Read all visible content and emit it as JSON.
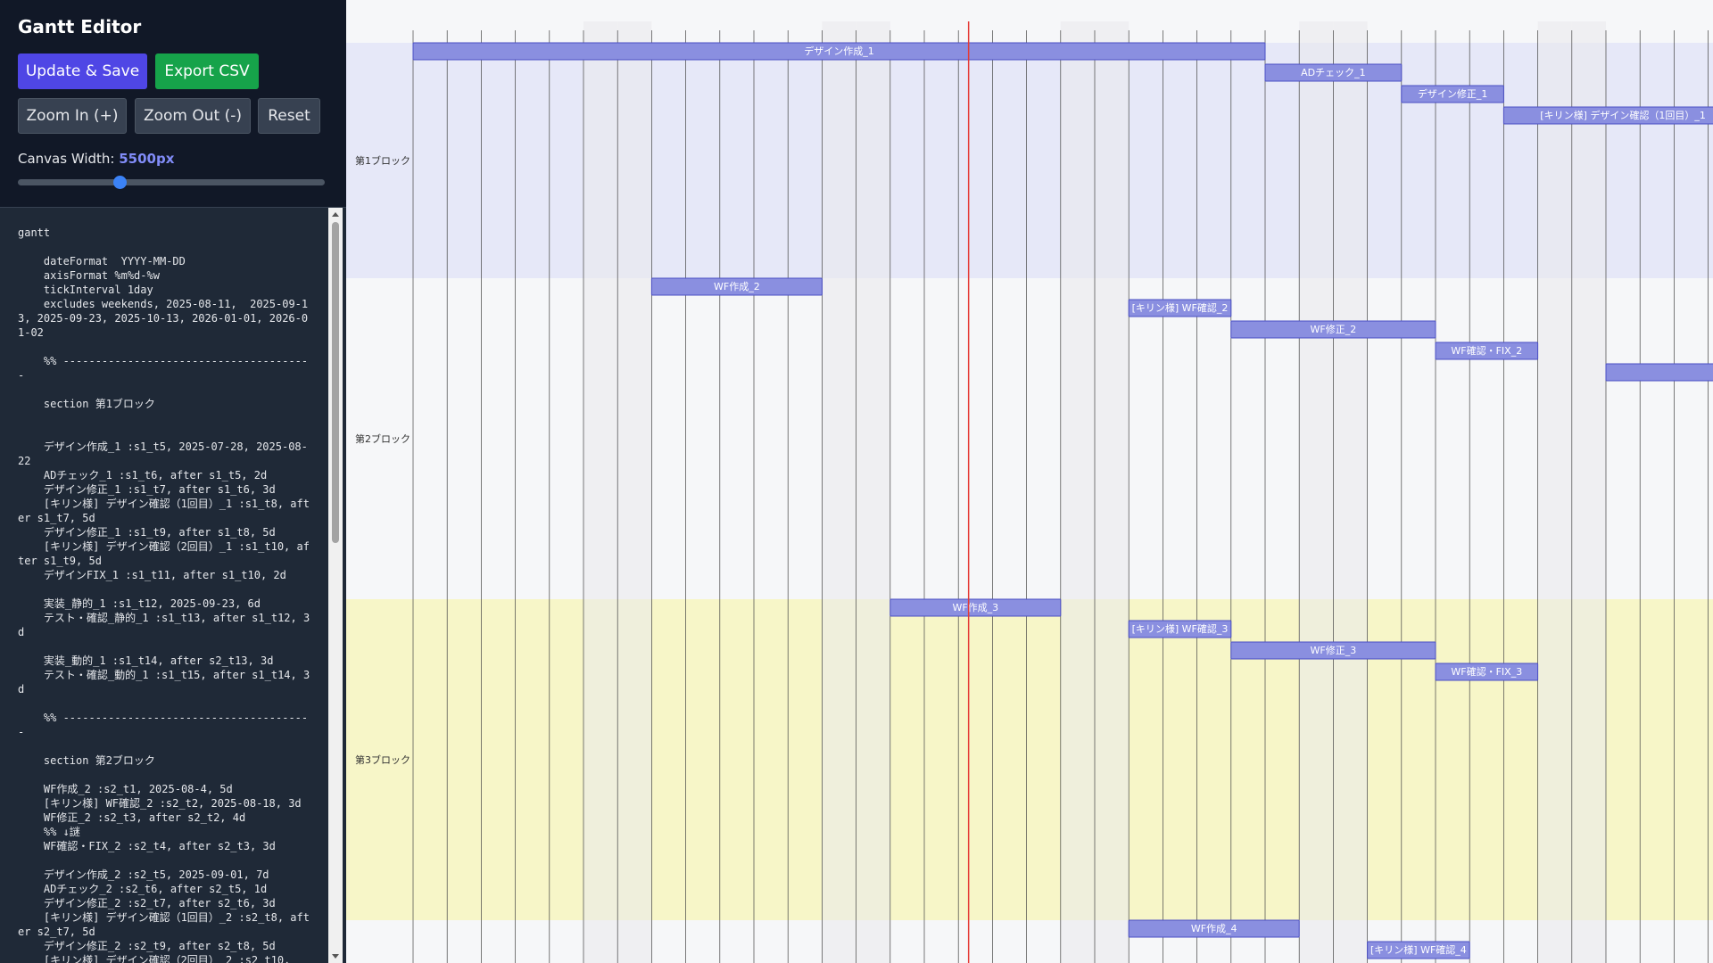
{
  "app": {
    "title": "Gantt Editor"
  },
  "toolbar": {
    "save_label": "Update & Save",
    "export_label": "Export CSV",
    "zoom_in_label": "Zoom In (+)",
    "zoom_out_label": "Zoom Out (-)",
    "reset_label": "Reset"
  },
  "canvas": {
    "width_label": "Canvas Width:",
    "width_value": "5500px",
    "slider_fraction": 0.33
  },
  "colors": {
    "primary_button": "#4f46e5",
    "export_button": "#16a34a",
    "task_bar": "#8a8fe0",
    "task_border": "#4b4fc4",
    "today_line": "#e53935",
    "section1_bg": "#e6e8f8",
    "section3_bg": "#f7f6c8",
    "weekend_shade": "#e9e9ec"
  },
  "code": {
    "text": "gantt\n\n    dateFormat  YYYY-MM-DD\n    axisFormat %m%d-%w\n    tickInterval 1day\n    excludes weekends, 2025-08-11,  2025-09-13, 2025-09-23, 2025-10-13, 2026-01-01, 2026-01-02\n\n    %% ---------------------------------------\n\n    section 第1ブロック\n\n\n    デザイン作成_1 :s1_t5, 2025-07-28, 2025-08-22\n    ADチェック_1 :s1_t6, after s1_t5, 2d\n    デザイン修正_1 :s1_t7, after s1_t6, 3d\n    [キリン様] デザイン確認（1回目）_1 :s1_t8, after s1_t7, 5d\n    デザイン修正_1 :s1_t9, after s1_t8, 5d\n    [キリン様] デザイン確認（2回目）_1 :s1_t10, after s1_t9, 5d\n    デザインFIX_1 :s1_t11, after s1_t10, 2d\n\n    実装_静的_1 :s1_t12, 2025-09-23, 6d\n    テスト・確認_静的_1 :s1_t13, after s1_t12, 3d\n\n    実装_動的_1 :s1_t14, after s2_t13, 3d\n    テスト・確認_動的_1 :s1_t15, after s1_t14, 3d\n\n    %% ---------------------------------------\n\n    section 第2ブロック\n\n    WF作成_2 :s2_t1, 2025-08-4, 5d\n    [キリン様] WF確認_2 :s2_t2, 2025-08-18, 3d\n    WF修正_2 :s2_t3, after s2_t2, 4d\n    %% ↓謎\n    WF確認・FIX_2 :s2_t4, after s2_t3, 3d\n\n    デザイン作成_2 :s2_t5, 2025-09-01, 7d\n    ADチェック_2 :s2_t6, after s2_t5, 1d\n    デザイン修正_2 :s2_t7, after s2_t6, 3d\n    [キリン様] デザイン確認（1回目）_2 :s2_t8, after s2_t7, 5d\n    デザイン修正_2 :s2_t9, after s2_t8, 5d\n    [キリン様] デザイン確認（2回目）_2 :s2_t10,"
  },
  "gantt": {
    "sections": [
      {
        "label": "第1ブロック",
        "tone": "section1"
      },
      {
        "label": "第2ブロック",
        "tone": "plain"
      },
      {
        "label": "第3ブロック",
        "tone": "section3"
      },
      {
        "label": "",
        "tone": "plain"
      }
    ],
    "tasks": [
      {
        "section": 0,
        "row": 0,
        "start": 0,
        "days": 25,
        "label": "デザイン作成_1"
      },
      {
        "section": 0,
        "row": 1,
        "start": 25,
        "days": 4,
        "label": "ADチェック_1"
      },
      {
        "section": 0,
        "row": 2,
        "start": 29,
        "days": 3,
        "label": "デザイン修正_1"
      },
      {
        "section": 0,
        "row": 3,
        "start": 32,
        "days": 7,
        "label": "[キリン様] デザイン確認（1回目）_1"
      },
      {
        "section": 1,
        "row": 0,
        "start": 7,
        "days": 5,
        "label": "WF作成_2"
      },
      {
        "section": 1,
        "row": 1,
        "start": 21,
        "days": 3,
        "label": "[キリン様] WF確認_2"
      },
      {
        "section": 1,
        "row": 2,
        "start": 24,
        "days": 6,
        "label": "WF修正_2"
      },
      {
        "section": 1,
        "row": 3,
        "start": 30,
        "days": 3,
        "label": "WF確認・FIX_2"
      },
      {
        "section": 1,
        "row": 4,
        "start": 35,
        "days": 4,
        "label": ""
      },
      {
        "section": 2,
        "row": 0,
        "start": 14,
        "days": 5,
        "label": "WF作成_3"
      },
      {
        "section": 2,
        "row": 1,
        "start": 21,
        "days": 3,
        "label": "[キリン様] WF確認_3"
      },
      {
        "section": 2,
        "row": 2,
        "start": 24,
        "days": 6,
        "label": "WF修正_3"
      },
      {
        "section": 2,
        "row": 3,
        "start": 30,
        "days": 3,
        "label": "WF確認・FIX_3"
      },
      {
        "section": 3,
        "row": 0,
        "start": 21,
        "days": 5,
        "label": "WF作成_4"
      },
      {
        "section": 3,
        "row": 1,
        "start": 28,
        "days": 3,
        "label": "[キリン様] WF確認_4"
      }
    ],
    "shaded_columns": [
      5,
      6,
      12,
      13,
      19,
      20,
      26,
      27,
      33,
      34
    ],
    "today_position_days": 16.3
  }
}
